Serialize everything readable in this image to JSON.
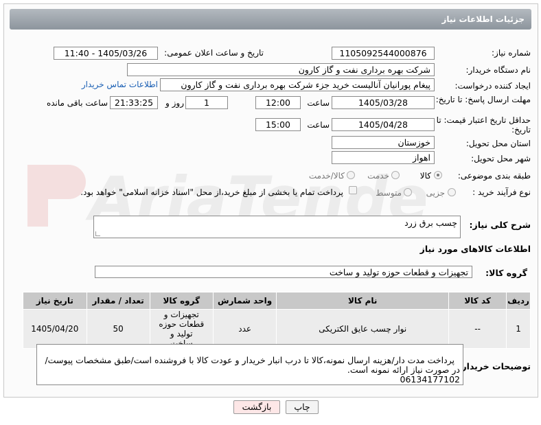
{
  "header": {
    "title": "جزئیات اطلاعات نیاز"
  },
  "fields": {
    "need_number_label": "شماره نیاز:",
    "need_number": "1105092544000876",
    "announce_label": "تاریخ و ساعت اعلان عمومی:",
    "announce_value": "1405/03/26 - 11:40",
    "buyer_org_label": "نام دستگاه خریدار:",
    "buyer_org": "شرکت بهره برداری نفت و گاز کارون",
    "creator_label": "ایجاد کننده درخواست:",
    "creator": "پیغام پورانیان آنالیست خرید جزء شرکت بهره برداری نفت و گاز کارون",
    "contact_link": "اطلاعات تماس خریدار",
    "deadline_label": "مهلت ارسال پاسخ: تا تاریخ:",
    "deadline_date": "1405/03/28",
    "hour_label": "ساعت",
    "deadline_time": "12:00",
    "day_and_label": "روز و",
    "days": "1",
    "remaining_time": "21:33:25",
    "remaining_label": "ساعت باقی مانده",
    "validity_label": "حداقل تاریخ اعتبار قیمت: تا تاریخ:",
    "validity_date": "1405/04/28",
    "hour_label2": "ساعت",
    "validity_time": "15:00",
    "province_label": "استان محل تحویل:",
    "province": "خوزستان",
    "city_label": "شهر محل تحویل:",
    "city": "اهواز",
    "category_label": "طبقه بندی موضوعی:",
    "category_options": [
      "کالا",
      "خدمت",
      "کالا/خدمت"
    ],
    "process_label": "نوع فرآیند خرید :",
    "process_options": [
      "جزیی",
      "متوسط"
    ],
    "payment_note": "پرداخت تمام یا بخشی از مبلغ خرید،از محل \"اسناد خزانه اسلامی\" خواهد بود.",
    "summary_label": "شرح کلی نیاز:",
    "summary": "چسب برق زرد",
    "goods_info_label": "اطلاعات کالاهای مورد نیاز",
    "goods_group_label": "گروه کالا:",
    "goods_group": "تجهیزات و قطعات حوزه تولید و ساخت"
  },
  "table": {
    "headers": [
      "ردیف",
      "کد کالا",
      "نام کالا",
      "واحد شمارش",
      "گروه کالا",
      "تعداد / مقدار",
      "تاریخ نیاز"
    ],
    "rows": [
      [
        "1",
        "--",
        "نوار چسب عایق الکتریکی",
        "عدد",
        "تجهیزات و قطعات حوزه تولید و ساخت",
        "50",
        "1405/04/20"
      ]
    ]
  },
  "buyer_notes": {
    "label": "توضیحات خریدار:",
    "text": "پرداخت مدت دار/هزینه ارسال نمونه،کالا تا درب انبار خریدار و عودت کالا با فروشنده است/طبق مشخصات پیوست/در صورت نیاز ارائه نمونه است.\n06134177102"
  },
  "buttons": {
    "print": "چاپ",
    "back": "بازگشت"
  },
  "watermark": "AriaTender.neT",
  "colors": {
    "back_button_bg": "#fde7e7",
    "header_bar": "#9aa1a8",
    "link": "#1a5fb4"
  }
}
